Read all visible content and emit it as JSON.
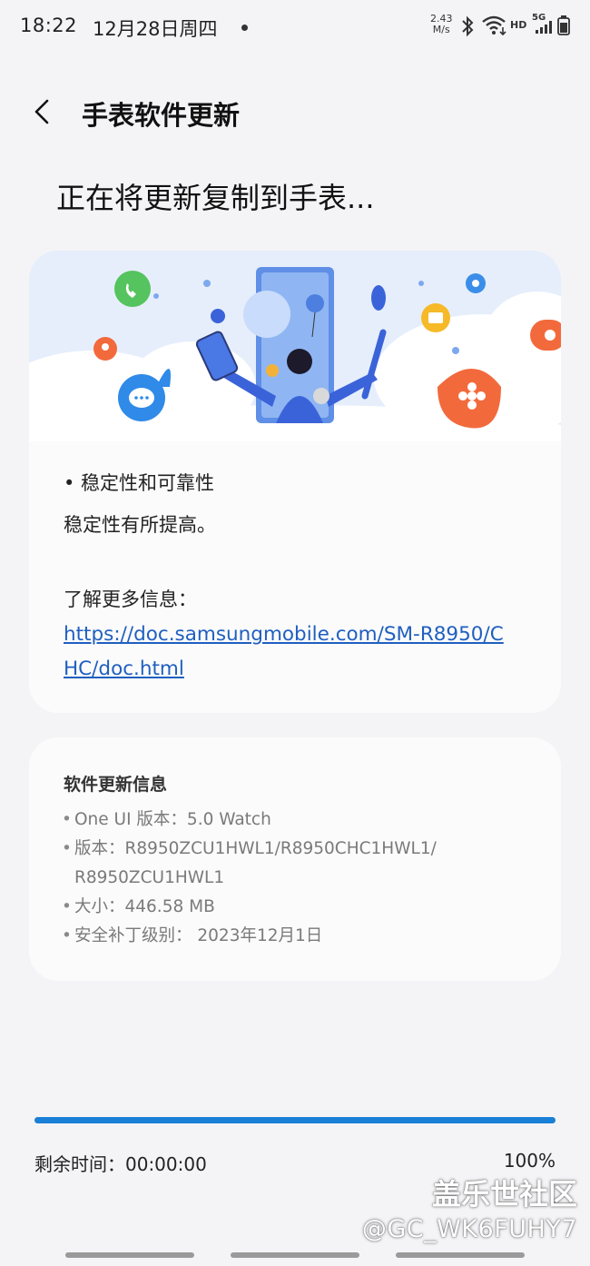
{
  "status_bar": {
    "time": "18:22",
    "date": "12月28日周四",
    "speed_value": "2.43",
    "speed_unit": "M/s",
    "network_label": "HD",
    "signal_label": "5G"
  },
  "header": {
    "title": "手表软件更新",
    "back_icon": "chevron-left-icon"
  },
  "page_heading": "正在将更新复制到手表...",
  "release_notes": {
    "bullet": "• 稳定性和可靠性",
    "text": "稳定性有所提高。",
    "more_info_label": "了解更多信息：",
    "link": "https://doc.samsungmobile.com/SM-R8950/CHC/doc.html"
  },
  "software_info": {
    "title": "软件更新信息",
    "items": [
      "One UI 版本：5.0 Watch",
      "版本：R8950ZCU1HWL1/R8950CHC1HWL1/ R8950ZCU1HWL1",
      "大小：446.58 MB",
      "安全补丁级别： 2023年12月1日"
    ]
  },
  "progress": {
    "fraction": 1.0,
    "remaining_label": "剩余时间：00:00:00",
    "percent_label": "100%"
  },
  "watermark": {
    "line1": "盖乐世社区",
    "line2": "@GC_WK6FUHY7"
  },
  "colors": {
    "accent": "#1a7fd6",
    "link": "#1f5fbf",
    "background": "#f4f4f6",
    "card": "#fbfbfc"
  }
}
